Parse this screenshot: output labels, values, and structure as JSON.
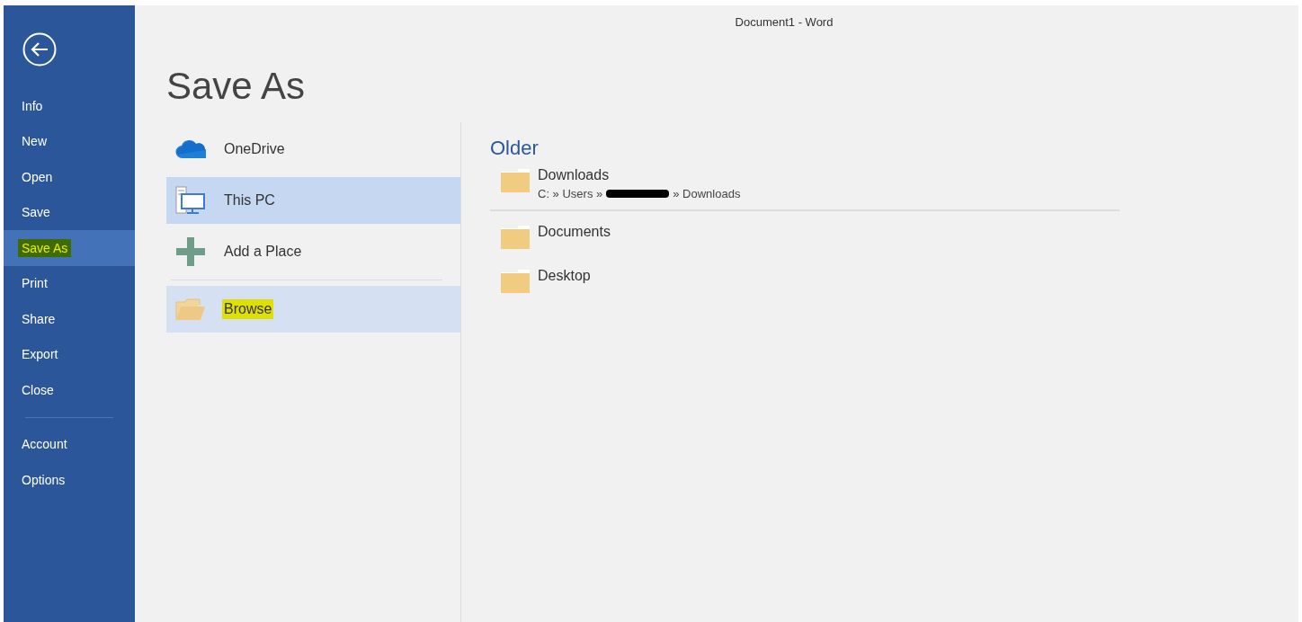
{
  "window": {
    "title": "Document1 - Word"
  },
  "nav": {
    "groups": [
      [
        {
          "label": "Info",
          "selected": false,
          "highlighted": false
        },
        {
          "label": "New",
          "selected": false,
          "highlighted": false
        },
        {
          "label": "Open",
          "selected": false,
          "highlighted": false
        },
        {
          "label": "Save",
          "selected": false,
          "highlighted": false
        },
        {
          "label": "Save As",
          "selected": true,
          "highlighted": true
        },
        {
          "label": "Print",
          "selected": false,
          "highlighted": false
        },
        {
          "label": "Share",
          "selected": false,
          "highlighted": false
        },
        {
          "label": "Export",
          "selected": false,
          "highlighted": false
        },
        {
          "label": "Close",
          "selected": false,
          "highlighted": false
        }
      ],
      [
        {
          "label": "Account",
          "selected": false,
          "highlighted": false
        },
        {
          "label": "Options",
          "selected": false,
          "highlighted": false
        }
      ]
    ]
  },
  "heading": "Save As",
  "places": [
    {
      "kind": "onedrive",
      "label": "OneDrive",
      "selected": false,
      "highlighted": false
    },
    {
      "kind": "pc",
      "label": "This PC",
      "selected": true,
      "highlighted": false
    },
    {
      "kind": "add",
      "label": "Add a Place",
      "selected": false,
      "highlighted": false
    },
    {
      "kind": "browse",
      "label": "Browse",
      "selected": false,
      "hovered": true,
      "highlighted": true
    }
  ],
  "recent": {
    "group": "Older",
    "folders": [
      {
        "name": "Downloads",
        "path_before": "C: » Users »",
        "redacted": true,
        "path_after": "» Downloads"
      },
      {
        "name": "Documents"
      },
      {
        "name": "Desktop"
      }
    ]
  }
}
